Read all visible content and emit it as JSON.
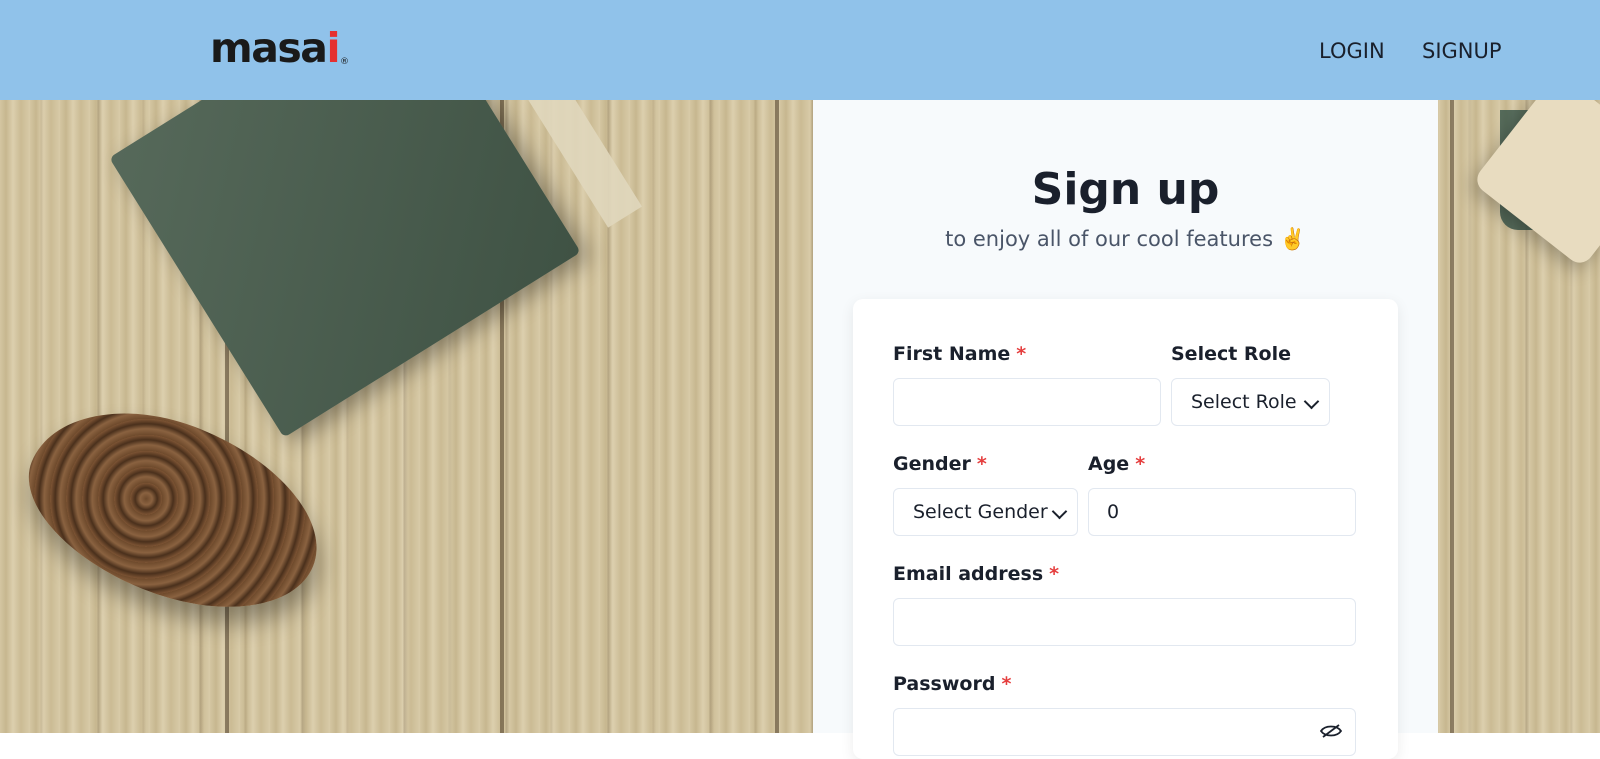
{
  "nav": {
    "logo_main": "masa",
    "logo_i": "i",
    "logo_mark": "®",
    "login": "LOGIN",
    "signup": "SIGNUP"
  },
  "panel": {
    "title": "Sign up",
    "subtitle": "to enjoy all of our cool features",
    "subtitle_emoji": "✌️"
  },
  "form": {
    "first_name": {
      "label": "First Name",
      "required": "*",
      "value": ""
    },
    "role": {
      "label": "Select Role",
      "selected": "Select Role"
    },
    "gender": {
      "label": "Gender",
      "required": "*",
      "selected": "Select Gender"
    },
    "age": {
      "label": "Age",
      "required": "*",
      "value": "0"
    },
    "email": {
      "label": "Email address",
      "required": "*",
      "value": ""
    },
    "password": {
      "label": "Password",
      "required": "*",
      "value": ""
    }
  },
  "colors": {
    "navbar": "#90c2ea",
    "panel": "#f7fafc",
    "required": "#e53e3e",
    "logo_accent": "#e53030"
  },
  "icons": [
    "chevron-down-icon",
    "eye-slash-icon"
  ]
}
